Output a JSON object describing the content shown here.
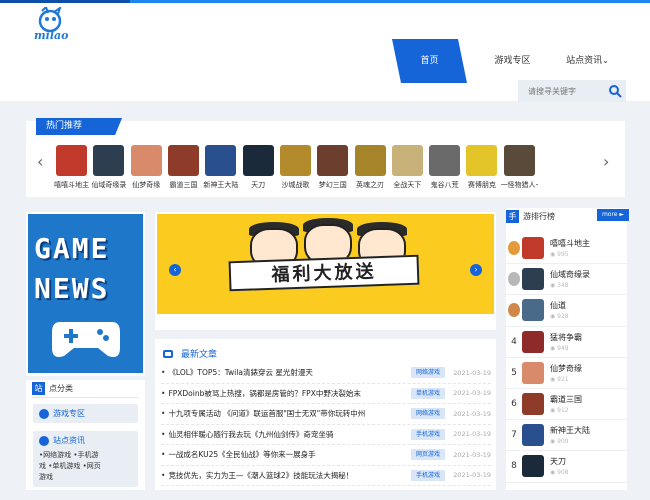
{
  "brand": {
    "logo_text": "milao"
  },
  "nav": {
    "items": [
      "首页",
      "游戏专区",
      "站点资讯"
    ],
    "dropdown_icon": "chevron-down-icon"
  },
  "search": {
    "placeholder": "请搜寻关键字"
  },
  "hot": {
    "title": "热门推荐",
    "games": [
      {
        "name": "嘻嘻斗地主",
        "color": "#c0392b"
      },
      {
        "name": "仙域奇缘录",
        "color": "#2c3e50"
      },
      {
        "name": "仙梦奇缘",
        "color": "#d98a6a"
      },
      {
        "name": "霸道三国",
        "color": "#8e3b2a"
      },
      {
        "name": "新神王大陆",
        "color": "#2a4f8e"
      },
      {
        "name": "天刀",
        "color": "#1b2a3a"
      },
      {
        "name": "沙城战歌",
        "color": "#b38a2c"
      },
      {
        "name": "梦幻三国",
        "color": "#6b3e2e"
      },
      {
        "name": "英魂之刃",
        "color": "#a6842a"
      },
      {
        "name": "全战天下",
        "color": "#c9b27a"
      },
      {
        "name": "鬼谷八荒",
        "color": "#6a6a6a"
      },
      {
        "name": "赛博朋克",
        "color": "#e3c52a"
      },
      {
        "name": "一怪物猎人一",
        "color": "#5a4a3a"
      }
    ]
  },
  "left_ad": {
    "line1": "GAME",
    "line2": "NEWS"
  },
  "categories": {
    "title_char": "站",
    "title": "点分类",
    "section1": "游戏专区",
    "section2": "站点资讯",
    "links_line1": "•网络游戏 •手机游",
    "links_line2": "戏 •单机游戏 •网页",
    "links_line3": "游戏"
  },
  "banner": {
    "text": "福利大放送"
  },
  "news": {
    "title": "最新文章",
    "items": [
      {
        "title": "《LOL》TOP5：Twila清錶穿云 星光射漫天",
        "tag": "网络游戏",
        "date": "2021-03-19"
      },
      {
        "title": "FPXDoinb被骂上热搜，锅都是房管的？FPX中野决裂始末",
        "tag": "单机游戏",
        "date": "2021-03-19"
      },
      {
        "title": "十九项专属活动 《问道》联运首服\"国士无双\"带你玩转中州",
        "tag": "网络游戏",
        "date": "2021-03-19"
      },
      {
        "title": "仙灵相伴暖心随行我去玩《九州仙剑传》奇宠坐骑",
        "tag": "手机游戏",
        "date": "2021-03-19"
      },
      {
        "title": "一战成名KU25《全民仙战》等你来一展身手",
        "tag": "网页游戏",
        "date": "2021-03-19"
      },
      {
        "title": "竞技优先，实力为王—《潮人篮球2》技能玩法大揭秘！",
        "tag": "手机游戏",
        "date": "2021-03-19"
      }
    ]
  },
  "rank": {
    "title_char": "手",
    "title": "游排行榜",
    "more": "more ►",
    "items": [
      {
        "no": "1",
        "name": "嘻嘻斗地主",
        "score": "995",
        "color": "#c0392b",
        "medal": "#e59a3a"
      },
      {
        "no": "2",
        "name": "仙域奇缘录",
        "score": "348",
        "color": "#2c3e50",
        "medal": "#b8b8b8"
      },
      {
        "no": "3",
        "name": "仙道",
        "score": "928",
        "color": "#4a6a8a",
        "medal": "#d0884a"
      },
      {
        "no": "4",
        "name": "猛将争霸",
        "score": "949",
        "color": "#8e2a2a",
        "medal": ""
      },
      {
        "no": "5",
        "name": "仙梦奇缘",
        "score": "921",
        "color": "#d98a6a",
        "medal": ""
      },
      {
        "no": "6",
        "name": "霸道三国",
        "score": "912",
        "color": "#8e3b2a",
        "medal": ""
      },
      {
        "no": "7",
        "name": "新神王大陆",
        "score": "909",
        "color": "#2a4f8e",
        "medal": ""
      },
      {
        "no": "8",
        "name": "天刀",
        "score": "908",
        "color": "#1b2a3a",
        "medal": ""
      }
    ]
  }
}
